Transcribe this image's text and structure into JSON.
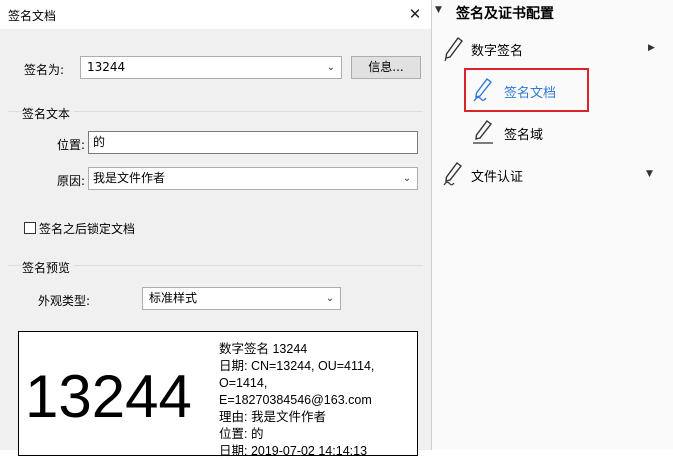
{
  "dialog": {
    "title": "签名文档",
    "close_glyph": "✕",
    "sign_as_label": "签名为:",
    "sign_as_value": "13244",
    "info_button": "信息...",
    "sign_text_group": "签名文本",
    "location_label": "位置:",
    "location_value": "的",
    "reason_label": "原因:",
    "reason_value": "我是文件作者",
    "lock_checkbox_label": "签名之后锁定文档",
    "lock_checked": false,
    "preview_group": "签名预览",
    "appearance_label": "外观类型:",
    "appearance_value": "标准样式",
    "preview": {
      "big_name": "13244",
      "lines": [
        "数字签名 13244",
        "日期: CN=13244, OU=4114,",
        "O=1414,",
        "E=18270384546@163.com",
        "理由: 我是文件作者",
        "位置: 的",
        "日期: 2019-07-02 14:14:13"
      ]
    }
  },
  "panel": {
    "header": "签名及证书配置",
    "items": [
      {
        "label": "数字签名",
        "icon": "pen-icon"
      },
      {
        "label": "签名文档",
        "icon": "pen-sign-icon"
      },
      {
        "label": "签名域",
        "icon": "signature-field-icon"
      },
      {
        "label": "文件认证",
        "icon": "certify-pen-icon"
      }
    ],
    "highlight_color": "#d9242b",
    "active_icon_color": "#2f79d6"
  }
}
